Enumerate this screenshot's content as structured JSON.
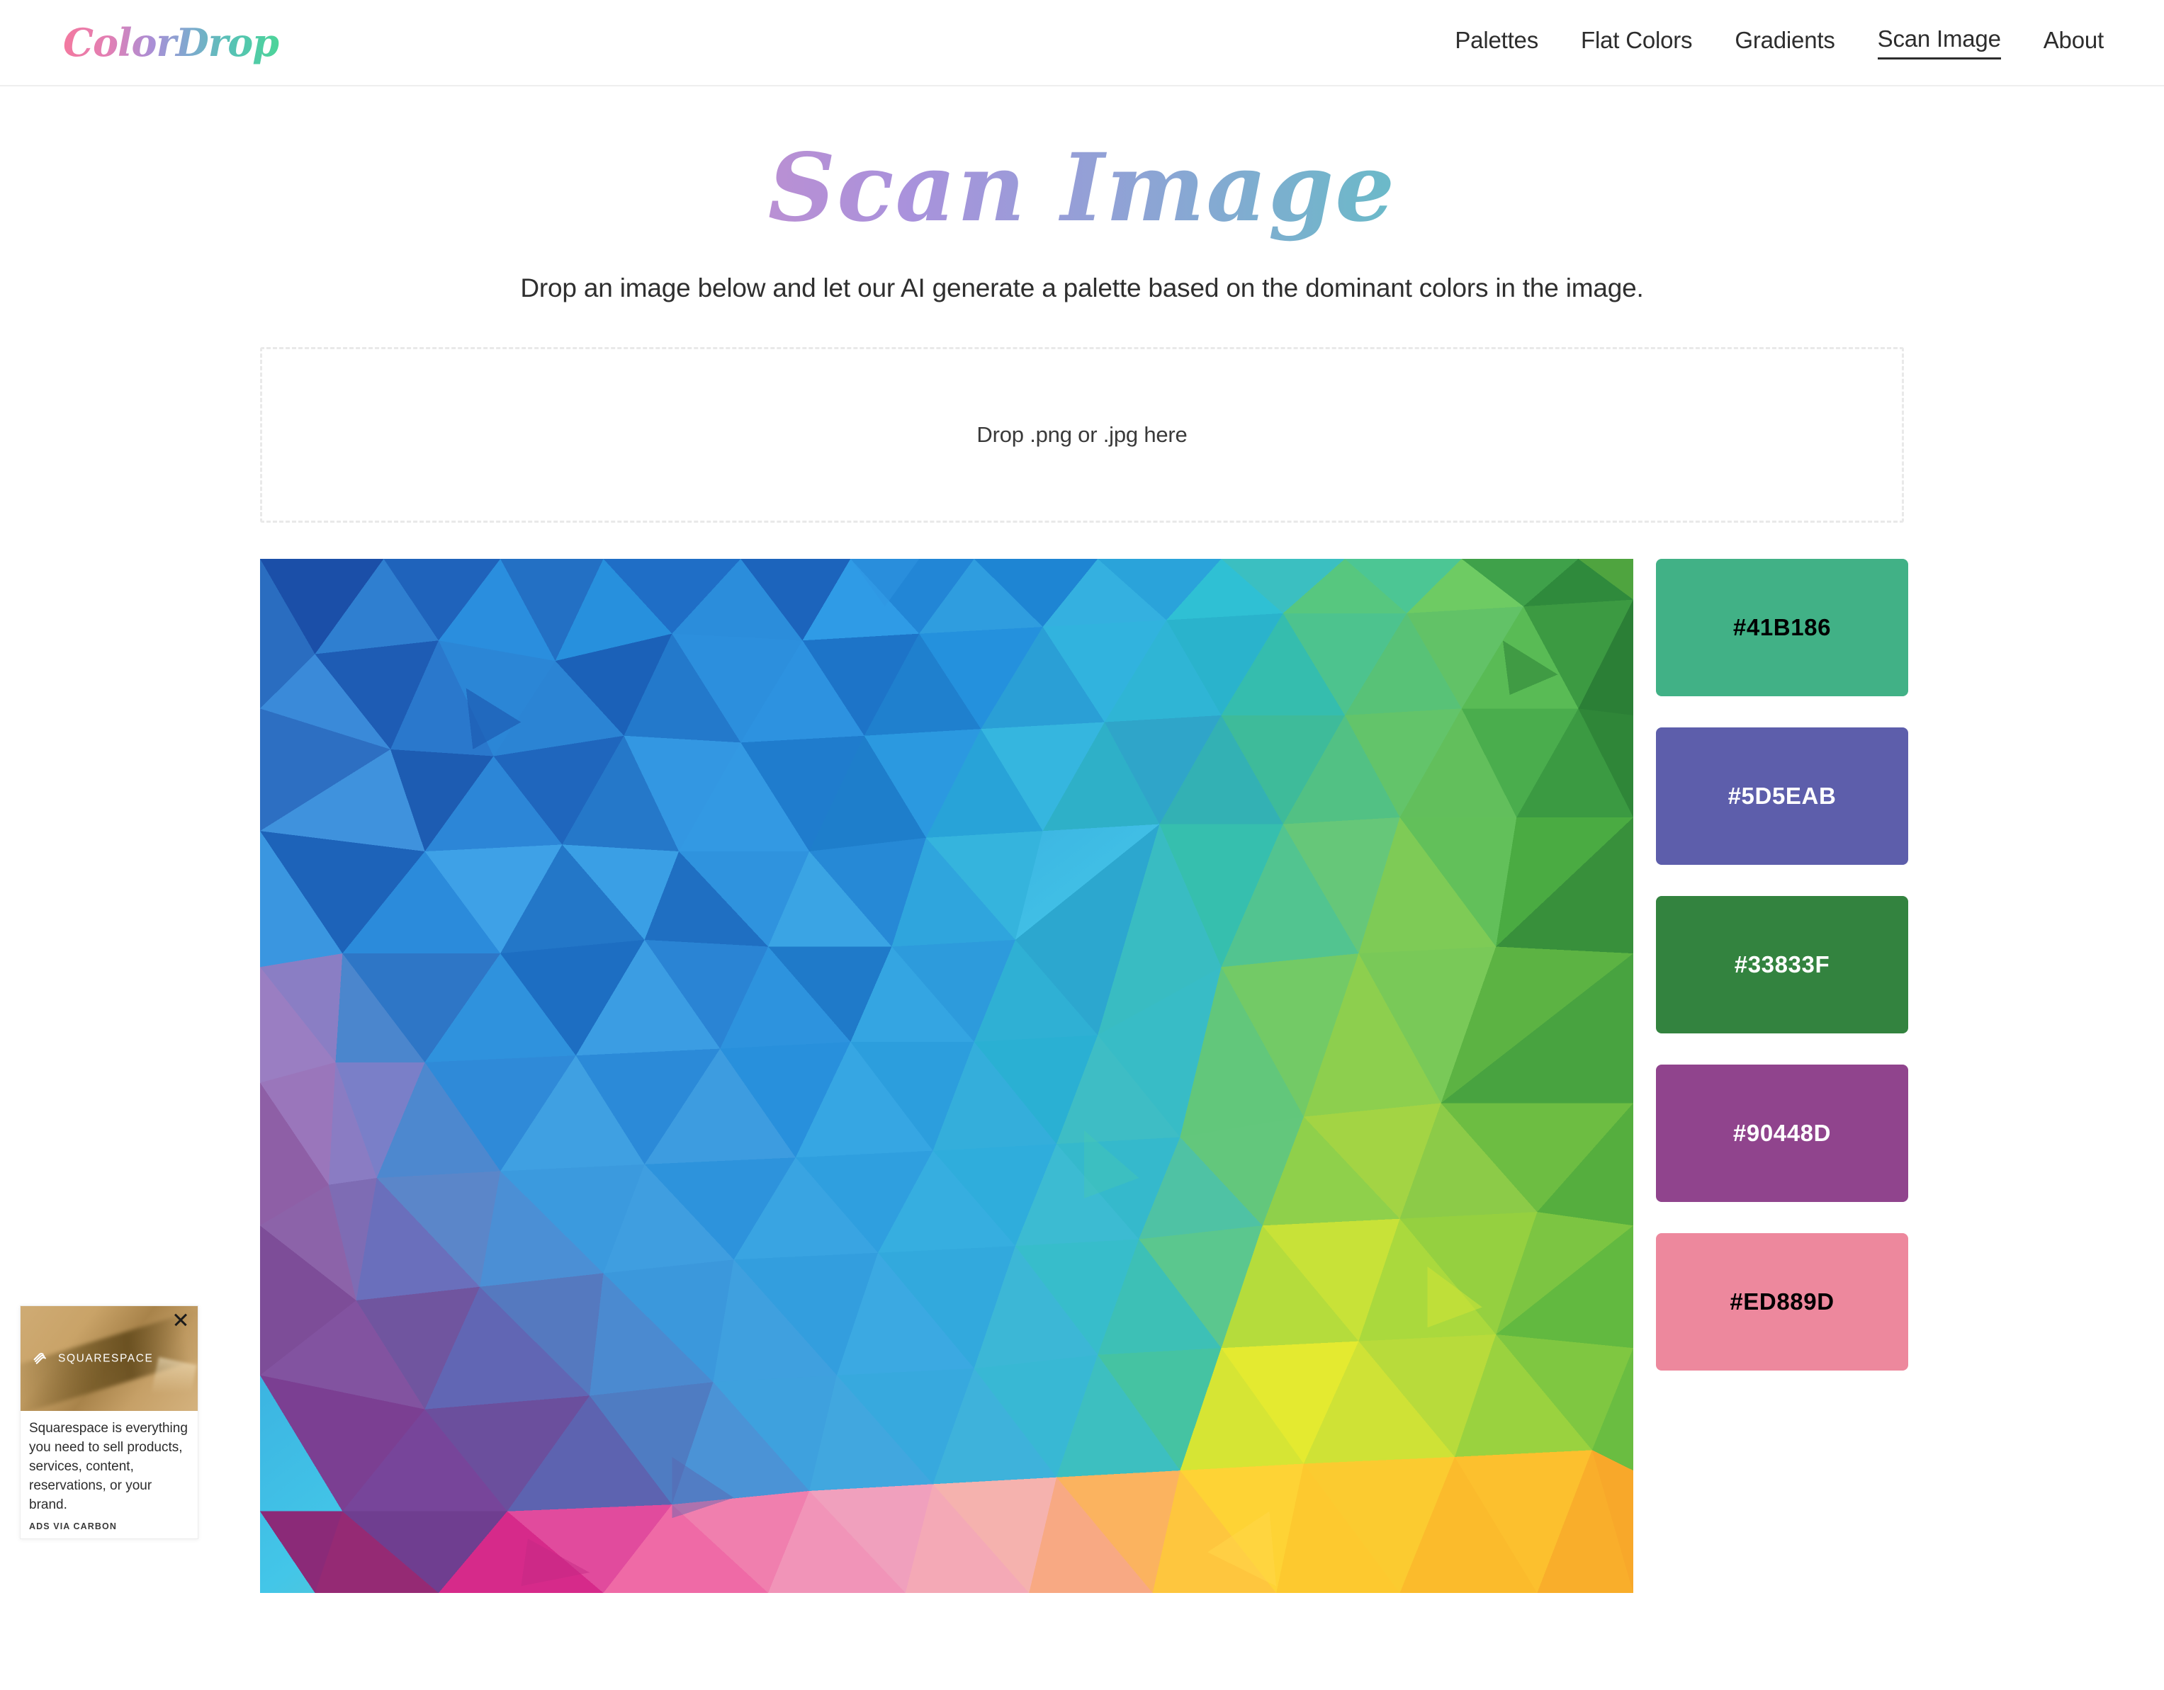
{
  "header": {
    "logo": "ColorDrop",
    "nav": [
      {
        "label": "Palettes",
        "active": false
      },
      {
        "label": "Flat Colors",
        "active": false
      },
      {
        "label": "Gradients",
        "active": false
      },
      {
        "label": "Scan Image",
        "active": true
      },
      {
        "label": "About",
        "active": false
      }
    ]
  },
  "main": {
    "title": "Scan Image",
    "subtitle": "Drop an image below and let our AI generate a palette based on the dominant colors in the image.",
    "dropzone": {
      "label": "Drop .png or .jpg here"
    },
    "swatches": [
      {
        "hex": "#41B186",
        "label": "#41B186",
        "text_color": "#000000"
      },
      {
        "hex": "#5D5EAB",
        "label": "#5D5EAB",
        "text_color": "#FFFFFF"
      },
      {
        "hex": "#33833F",
        "label": "#33833F",
        "text_color": "#FFFFFF"
      },
      {
        "hex": "#90448D",
        "label": "#90448D",
        "text_color": "#FFFFFF"
      },
      {
        "hex": "#ED889D",
        "label": "#ED889D",
        "text_color": "#000000"
      }
    ],
    "preview": {
      "alt": "low-poly rainbow triangle mosaic"
    }
  },
  "ad": {
    "brand": "SQUARESPACE",
    "text": "Squarespace is everything you need to sell products, services, content, reservations, or your brand.",
    "powered_by": "ADS VIA CARBON",
    "close_label": "close-ad"
  },
  "theme": {
    "background": "#FFFFFF",
    "text": "#2D2D2D",
    "border": "#EEEEEE",
    "dropzone_border": "#E9E9E9",
    "gradient_start": "#F4799E",
    "gradient_mid": "#A992DC",
    "gradient_end": "#5AD09A"
  }
}
